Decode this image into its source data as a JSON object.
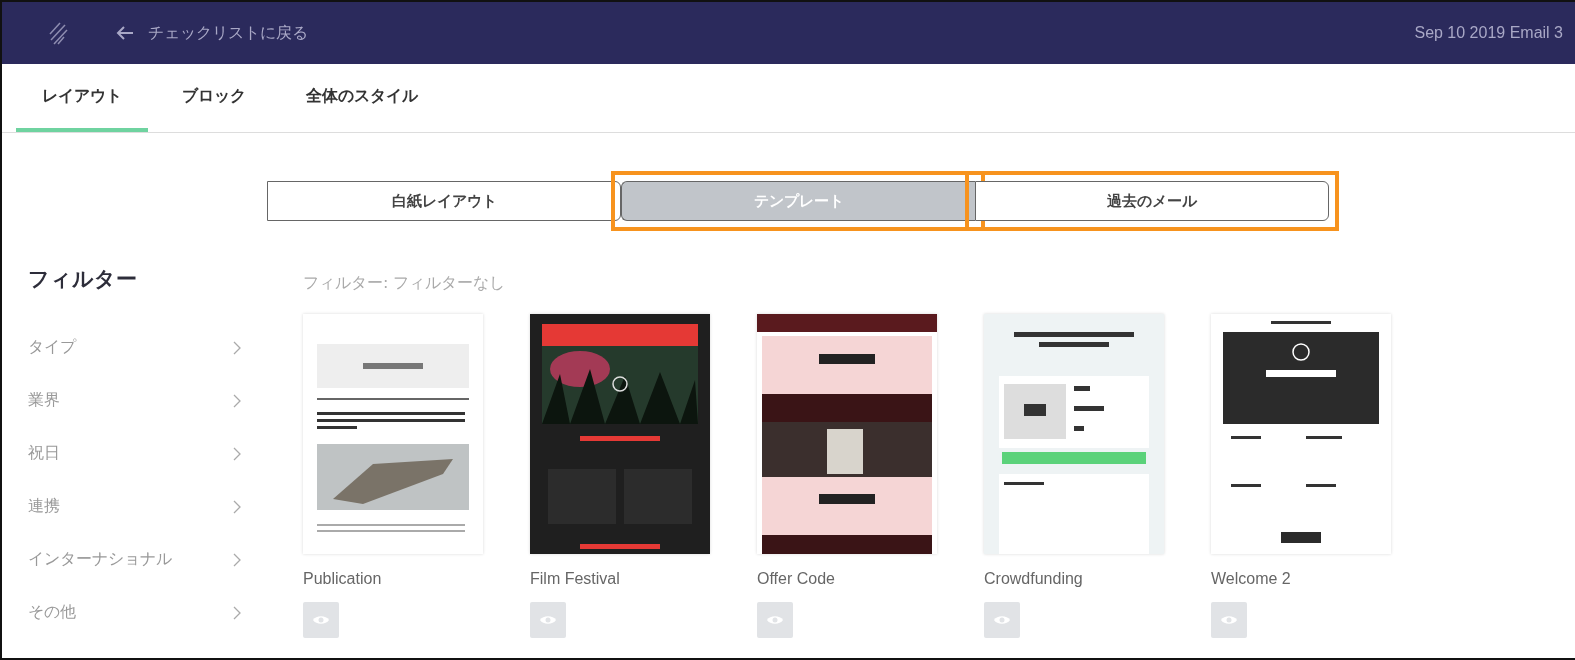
{
  "header": {
    "back_label": "チェックリストに戻る",
    "document_title": "Sep 10 2019 Email 3"
  },
  "tabs": [
    {
      "label": "レイアウト",
      "selected": true
    },
    {
      "label": "ブロック",
      "selected": false
    },
    {
      "label": "全体のスタイル",
      "selected": false
    }
  ],
  "layout_modes": [
    {
      "label": "白紙レイアウト",
      "selected": false,
      "highlighted": false
    },
    {
      "label": "テンプレート",
      "selected": true,
      "highlighted": true
    },
    {
      "label": "過去のメール",
      "selected": false,
      "highlighted": true
    }
  ],
  "sidebar": {
    "title": "フィルター",
    "items": [
      {
        "label": "タイプ"
      },
      {
        "label": "業界"
      },
      {
        "label": "祝日"
      },
      {
        "label": "連携"
      },
      {
        "label": "インターナショナル"
      },
      {
        "label": "その他"
      }
    ]
  },
  "active_filter": "フィルター: フィルターなし",
  "templates": [
    {
      "name": "Publication",
      "kind": "publication"
    },
    {
      "name": "Film Festival",
      "kind": "film"
    },
    {
      "name": "Offer Code",
      "kind": "offer"
    },
    {
      "name": "Crowdfunding",
      "kind": "crowdfunding"
    },
    {
      "name": "Welcome 2",
      "kind": "welcome"
    }
  ]
}
